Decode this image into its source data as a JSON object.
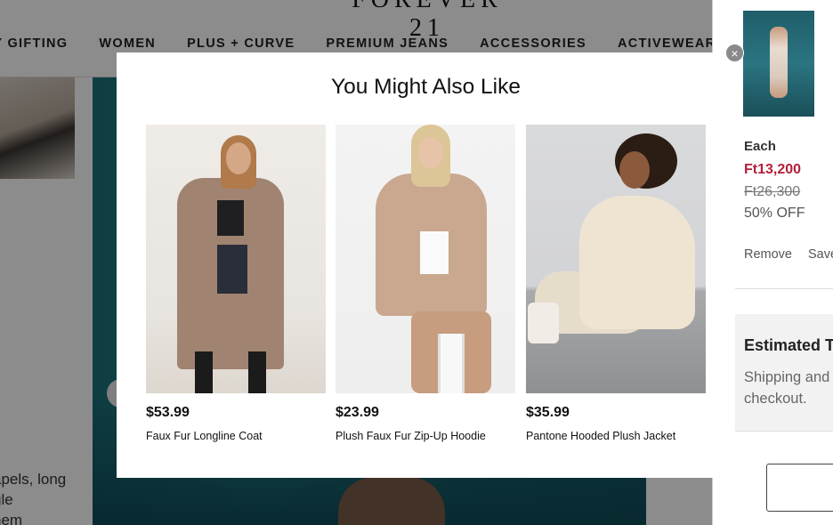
{
  "header": {
    "logo_text": "FOREVER 21",
    "nav_items": [
      "AY GIFTING",
      "WOMEN",
      "PLUS + CURVE",
      "PREMIUM JEANS",
      "ACCESSORIES",
      "ACTIVEWEAR"
    ]
  },
  "product_description": {
    "lines": [
      "apels, long",
      "gle",
      "hem"
    ]
  },
  "cart": {
    "each_label": "Each",
    "sale_price": "Ft13,200",
    "original_price": "Ft26,300",
    "discount": "50% OFF",
    "remove_label": "Remove",
    "save_label": "Save",
    "totals_title": "Estimated T",
    "totals_note_line1": "Shipping and",
    "totals_note_line2": "checkout."
  },
  "modal": {
    "title": "You Might Also Like",
    "close_glyph": "×",
    "products": [
      {
        "price": "$53.99",
        "name": "Faux Fur Longline Coat"
      },
      {
        "price": "$23.99",
        "name": "Plush Faux Fur Zip-Up Hoodie"
      },
      {
        "price": "$35.99",
        "name": "Pantone Hooded Plush Jacket"
      }
    ]
  },
  "colors": {
    "sale_price": "#b41f3a",
    "overlay": "rgba(0,0,0,0.45)",
    "hero_backdrop": "#1e7580"
  }
}
